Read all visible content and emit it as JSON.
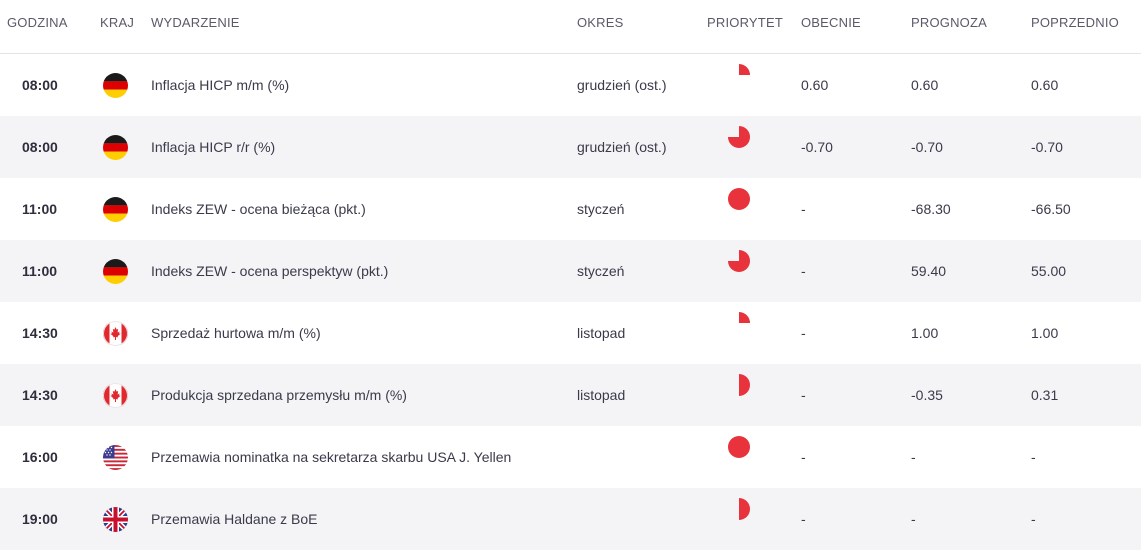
{
  "headers": {
    "godzina": "GODZINA",
    "kraj": "KRAJ",
    "wydarzenie": "WYDARZENIE",
    "okres": "OKRES",
    "priorytet": "PRIORYTET",
    "obecnie": "OBECNIE",
    "prognoza": "PROGNOZA",
    "poprzednio": "POPRZEDNIO"
  },
  "colors": {
    "priority": "#e8323c",
    "row_alt": "#f4f4f7"
  },
  "rows": [
    {
      "time": "08:00",
      "country": "germany",
      "event": "Inflacja HICP m/m (%)",
      "period": "grudzień (ost.)",
      "priority": 0.25,
      "actual": "0.60",
      "forecast": "0.60",
      "previous": "0.60"
    },
    {
      "time": "08:00",
      "country": "germany",
      "event": "Inflacja HICP r/r (%)",
      "period": "grudzień (ost.)",
      "priority": 0.75,
      "actual": "-0.70",
      "forecast": "-0.70",
      "previous": "-0.70"
    },
    {
      "time": "11:00",
      "country": "germany",
      "event": "Indeks ZEW - ocena bieżąca (pkt.)",
      "period": "styczeń",
      "priority": 1.0,
      "actual": "-",
      "forecast": "-68.30",
      "previous": "-66.50"
    },
    {
      "time": "11:00",
      "country": "germany",
      "event": "Indeks ZEW - ocena perspektyw (pkt.)",
      "period": "styczeń",
      "priority": 0.75,
      "actual": "-",
      "forecast": "59.40",
      "previous": "55.00"
    },
    {
      "time": "14:30",
      "country": "canada",
      "event": "Sprzedaż hurtowa m/m (%)",
      "period": "listopad",
      "priority": 0.25,
      "actual": "-",
      "forecast": "1.00",
      "previous": "1.00"
    },
    {
      "time": "14:30",
      "country": "canada",
      "event": "Produkcja sprzedana przemysłu m/m (%)",
      "period": "listopad",
      "priority": 0.5,
      "actual": "-",
      "forecast": "-0.35",
      "previous": "0.31"
    },
    {
      "time": "16:00",
      "country": "usa",
      "event": "Przemawia nominatka na sekretarza skarbu USA J. Yellen",
      "period": "",
      "priority": 1.0,
      "actual": "-",
      "forecast": "-",
      "previous": "-"
    },
    {
      "time": "19:00",
      "country": "uk",
      "event": "Przemawia Haldane z BoE",
      "period": "",
      "priority": 0.5,
      "actual": "-",
      "forecast": "-",
      "previous": "-"
    }
  ]
}
